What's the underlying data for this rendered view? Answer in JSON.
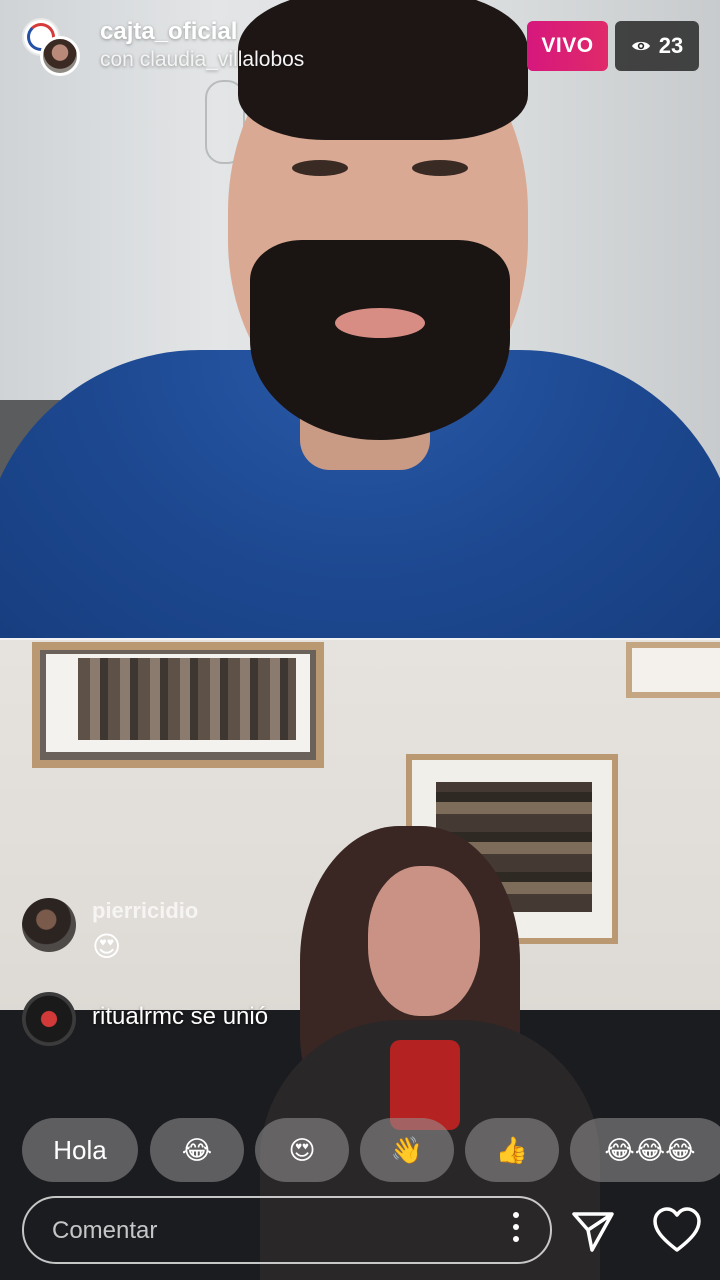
{
  "header": {
    "host_username": "cajta_oficial",
    "guest_line": "con claudia_villalobos",
    "live_label": "VIVO",
    "viewer_count": "23"
  },
  "comments": [
    {
      "username": "pierricidio",
      "text": "😍"
    },
    {
      "text": "ritualrmc se unió"
    }
  ],
  "quick_reactions": [
    "Hola",
    "😂",
    "😍",
    "👋",
    "👍",
    "😂😂😂"
  ],
  "composer": {
    "placeholder": "Comentar"
  },
  "icons": {
    "viewers": "eye-icon",
    "more": "more-vertical-icon",
    "send": "send-icon",
    "like": "heart-icon"
  },
  "colors": {
    "live_badge": "#d6177d",
    "viewer_badge": "#282828"
  }
}
